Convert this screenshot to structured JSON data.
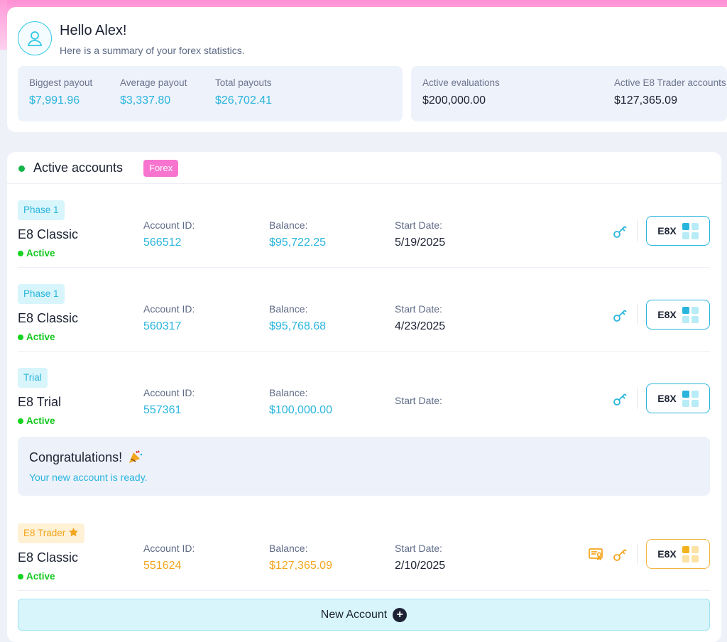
{
  "header": {
    "greeting": "Hello Alex!",
    "subtitle": "Here is a summary of your forex statistics."
  },
  "stats": {
    "biggest_label": "Biggest payout",
    "biggest_value": "$7,991.96",
    "average_label": "Average payout",
    "average_value": "$3,337.80",
    "total_label": "Total payouts",
    "total_value": "$26,702.41",
    "evals_label": "Active evaluations",
    "evals_value": "$200,000.00",
    "trader_label": "Active E8 Trader accounts",
    "trader_value": "$127,365.09"
  },
  "accounts": {
    "title": "Active accounts",
    "badge": "Forex",
    "labels": {
      "account_id": "Account ID:",
      "balance": "Balance:",
      "start_date": "Start Date:",
      "e8x": "E8X"
    },
    "rows": [
      {
        "phase": "Phase 1",
        "name": "E8 Classic",
        "status": "Active",
        "account_id": "566512",
        "balance": "$95,722.25",
        "start_date": "5/19/2025"
      },
      {
        "phase": "Phase 1",
        "name": "E8 Classic",
        "status": "Active",
        "account_id": "560317",
        "balance": "$95,768.68",
        "start_date": "4/23/2025"
      },
      {
        "phase": "Trial",
        "name": "E8 Trial",
        "status": "Active",
        "account_id": "557361",
        "balance": "$100,000.00",
        "start_date": ""
      },
      {
        "phase": "E8 Trader",
        "name": "E8 Classic",
        "status": "Active",
        "account_id": "551624",
        "balance": "$127,365.09",
        "start_date": "2/10/2025"
      }
    ]
  },
  "congrats": {
    "title": "Congratulations!",
    "subtitle": "Your new account is ready."
  },
  "new_account_label": "New Account",
  "colors": {
    "accent": "#2ab5dd",
    "gold": "#f2a51d",
    "active": "#14c81f",
    "forex_badge": "#f874cf"
  }
}
